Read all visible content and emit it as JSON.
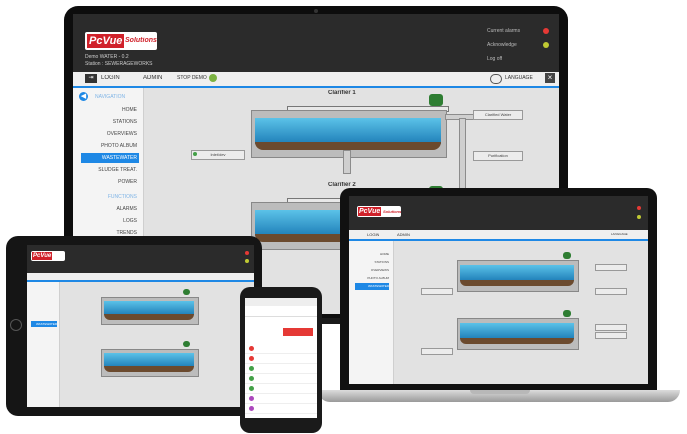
{
  "app": {
    "logo_main": "PcVue",
    "logo_sub": "Solutions",
    "header_info_line1": "Demo WATER - 0.2",
    "header_info_line2": "Station : SEWERAGEWORKS",
    "status_line1": "Current alarms",
    "status_line2": "Acknowledge",
    "status_line3": "Log off"
  },
  "menubar": {
    "login": "LOGIN",
    "user": "ADMIN",
    "stop_label": "STOP DEMO",
    "language": "LANGUAGE"
  },
  "navigation": {
    "header": "NAVIGATION",
    "items": [
      "HOME",
      "STATIONS",
      "OVERVIEWS",
      "PHOTO ALBUM",
      "WASTEWATER",
      "SLUDGE TREAT.",
      "POWER"
    ],
    "active_index": 4,
    "functions_header": "FUNCTIONS",
    "function_items": [
      "ALARMS",
      "LOGS",
      "TRENDS"
    ]
  },
  "mimic": {
    "clarifier1_title": "Clarifier 1",
    "clarifier2_title": "Clarifier 2",
    "btn_clarified_water": "Clarified Water",
    "btn_inlet": "Inlet/dev",
    "btn_purification": "Purification"
  },
  "colors": {
    "brand_red": "#d0212a",
    "nav_active_blue": "#1e88e5",
    "water_blue": "#2a8ec8",
    "motor_green": "#2e7d32",
    "sludge_brown": "#6b4a2e"
  },
  "icons": {
    "back": "arrow-left-icon",
    "language": "speech-bubble-icon",
    "close": "close-icon",
    "stop": "stop-circle-icon"
  }
}
